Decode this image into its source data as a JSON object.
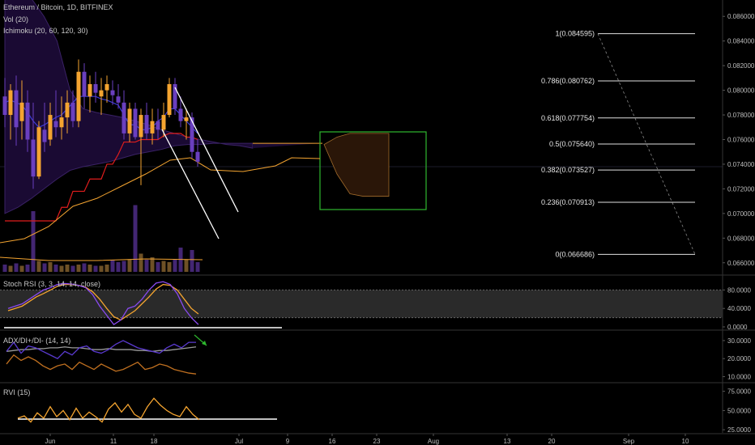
{
  "header": {
    "title": "Ethereum / Bitcoin, 1D, BITFINEX",
    "volume": "Vol (20)",
    "ichimoku": "Ichimoku (20, 60, 120, 30)"
  },
  "colors": {
    "bull": "#f4a430",
    "bear": "#6a3fbf",
    "kijun": "#e11d1d",
    "tenkan": "#3b3bd8",
    "cloud": "#1a0a33",
    "lagging": "#f4a430",
    "box": "#2eb82e"
  },
  "chart_data": {
    "type": "candlestick",
    "price_axis": {
      "ylim": [
        0.065,
        0.087
      ],
      "ticks": [
        "0.086000",
        "0.084000",
        "0.082000",
        "0.080000",
        "0.078000",
        "0.076000",
        "0.074000",
        "0.072000",
        "0.070000",
        "0.068000",
        "0.066000"
      ]
    },
    "x_ticks": [
      "Jun",
      "11",
      "18",
      "Jul",
      "9",
      "16",
      "23",
      "Aug",
      "13",
      "20",
      "Sep",
      "10"
    ],
    "candles": [
      [
        0.0795,
        0.081,
        0.077,
        0.078
      ],
      [
        0.078,
        0.0805,
        0.076,
        0.08
      ],
      [
        0.08,
        0.0812,
        0.0755,
        0.077
      ],
      [
        0.0775,
        0.0808,
        0.076,
        0.079
      ],
      [
        0.079,
        0.08,
        0.075,
        0.076
      ],
      [
        0.076,
        0.079,
        0.072,
        0.073
      ],
      [
        0.073,
        0.0775,
        0.0728,
        0.077
      ],
      [
        0.0768,
        0.079,
        0.075,
        0.0758
      ],
      [
        0.076,
        0.079,
        0.0755,
        0.078
      ],
      [
        0.0775,
        0.08,
        0.0762,
        0.077
      ],
      [
        0.077,
        0.0795,
        0.076,
        0.0778
      ],
      [
        0.0778,
        0.08,
        0.0765,
        0.079
      ],
      [
        0.079,
        0.08,
        0.077,
        0.0775
      ],
      [
        0.0775,
        0.0825,
        0.077,
        0.0815
      ],
      [
        0.0815,
        0.0822,
        0.0785,
        0.0795
      ],
      [
        0.0795,
        0.0812,
        0.0782,
        0.0805
      ],
      [
        0.0805,
        0.0815,
        0.079,
        0.0798
      ],
      [
        0.0795,
        0.081,
        0.078,
        0.08
      ],
      [
        0.08,
        0.0812,
        0.079,
        0.0805
      ],
      [
        0.08,
        0.0808,
        0.0788,
        0.0796
      ],
      [
        0.0795,
        0.0805,
        0.0785,
        0.079
      ],
      [
        0.079,
        0.08,
        0.076,
        0.0765
      ],
      [
        0.0765,
        0.079,
        0.0758,
        0.0785
      ],
      [
        0.0785,
        0.079,
        0.076,
        0.0762
      ],
      [
        0.0762,
        0.0785,
        0.0723,
        0.078
      ],
      [
        0.078,
        0.079,
        0.076,
        0.0765
      ],
      [
        0.0765,
        0.0785,
        0.0756,
        0.0775
      ],
      [
        0.0775,
        0.0785,
        0.076,
        0.0768
      ],
      [
        0.0768,
        0.079,
        0.0762,
        0.078
      ],
      [
        0.078,
        0.081,
        0.0778,
        0.0805
      ],
      [
        0.0805,
        0.081,
        0.078,
        0.0785
      ],
      [
        0.0785,
        0.0795,
        0.077,
        0.0775
      ],
      [
        0.0775,
        0.0785,
        0.076,
        0.0778
      ],
      [
        0.0778,
        0.0782,
        0.0745,
        0.075
      ],
      [
        0.075,
        0.076,
        0.0738,
        0.0742
      ]
    ],
    "volume": [
      0.06,
      0.05,
      0.07,
      0.05,
      0.06,
      0.5,
      0.09,
      0.07,
      0.08,
      0.06,
      0.05,
      0.06,
      0.05,
      0.06,
      0.07,
      0.06,
      0.05,
      0.05,
      0.06,
      0.1,
      0.08,
      0.09,
      0.1,
      0.55,
      0.15,
      0.1,
      0.12,
      0.08,
      0.09,
      0.08,
      0.1,
      0.2,
      0.1,
      0.18,
      0.08
    ],
    "kijun": [
      0.0694,
      0.0694,
      0.0694,
      0.0694,
      0.0694,
      0.0694,
      0.0694,
      0.0694,
      0.0694,
      0.0694,
      0.0705,
      0.0705,
      0.0718,
      0.0718,
      0.0718,
      0.0728,
      0.0728,
      0.0728,
      0.074,
      0.074,
      0.0748,
      0.0758,
      0.0758,
      0.0758,
      0.076,
      0.076,
      0.076,
      0.076,
      0.0763,
      0.0765,
      0.0765,
      0.0765,
      0.0762,
      0.0762,
      0.076
    ],
    "tenkan": [
      0.079,
      0.0792,
      0.079,
      0.0788,
      0.0782,
      0.0775,
      0.077,
      0.0772,
      0.0775,
      0.0778,
      0.078,
      0.0785,
      0.079,
      0.0795,
      0.0795,
      0.0795,
      0.0795,
      0.0793,
      0.0792,
      0.079,
      0.0788,
      0.078,
      0.0772,
      0.0772,
      0.0768,
      0.0768,
      0.077,
      0.0775,
      0.0778,
      0.0785,
      0.0785,
      0.078,
      0.0775,
      0.077,
      0.0765
    ],
    "cloud_top": [
      0.09,
      0.089,
      0.0875,
      0.086,
      0.084,
      0.08,
      0.0785,
      0.0782,
      0.078,
      0.0778,
      0.0775,
      0.0772,
      0.0768,
      0.0765,
      0.0762,
      0.076,
      0.0758,
      0.0756,
      0.0755,
      0.0753
    ],
    "cloud_bottom": [
      0.07,
      0.0705,
      0.0712,
      0.072,
      0.0728,
      0.0735,
      0.0738,
      0.074,
      0.0742,
      0.0745,
      0.0748,
      0.075,
      0.0752,
      0.0755,
      0.0756,
      0.0756,
      0.0757,
      0.0757,
      0.0757,
      0.0757
    ],
    "future_cloud_top": [
      0.0756,
      0.0762,
      0.0765,
      0.0765,
      0.0765,
      0.0765
    ],
    "future_cloud_bottom": [
      0.0756,
      0.0732,
      0.0716,
      0.0714,
      0.0714,
      0.0714
    ],
    "fib_levels": [
      {
        "label": "1(0.084595)",
        "value": 0.084595
      },
      {
        "label": "0.786(0.080762)",
        "value": 0.080762
      },
      {
        "label": "0.618(0.077754)",
        "value": 0.077754
      },
      {
        "label": "0.5(0.075640)",
        "value": 0.07564
      },
      {
        "label": "0.382(0.073527)",
        "value": 0.073527
      },
      {
        "label": "0.236(0.070913)",
        "value": 0.070913
      },
      {
        "label": "0(0.066686)",
        "value": 0.066686
      }
    ],
    "stoch_rsi": {
      "title": "Stoch RSI (3, 3, 14, 14, close)",
      "ylim": [
        0,
        100
      ],
      "ticks": [
        "80.0000",
        "40.0000",
        "0.0000"
      ],
      "band": [
        20,
        80
      ],
      "k": [
        40,
        45,
        50,
        60,
        70,
        80,
        85,
        92,
        94,
        93,
        90,
        85,
        70,
        45,
        25,
        5,
        15,
        40,
        45,
        60,
        80,
        95,
        98,
        92,
        72,
        40,
        20,
        5
      ],
      "d": [
        35,
        40,
        45,
        55,
        65,
        72,
        80,
        88,
        92,
        92,
        90,
        86,
        76,
        60,
        40,
        22,
        15,
        25,
        35,
        50,
        65,
        82,
        92,
        90,
        80,
        60,
        40,
        28
      ]
    },
    "adx": {
      "title": "ADX/DI+/DI- (14, 14)",
      "ylim": [
        8,
        34
      ],
      "ticks": [
        "30.0000",
        "20.0000",
        "10.0000"
      ],
      "adx": [
        24,
        24.5,
        25,
        25,
        25.5,
        25.5,
        26,
        26,
        26.5,
        26,
        26,
        25.5,
        25,
        25,
        25.5,
        25,
        25,
        25,
        24.5,
        24.5,
        24,
        24.5,
        24.5,
        25,
        25.5,
        26,
        26.5
      ],
      "di_plus": [
        24,
        29,
        23,
        27,
        26,
        24,
        22,
        20,
        24,
        22,
        26,
        27,
        24,
        23,
        25,
        28,
        30,
        28,
        26,
        25,
        24,
        23,
        26,
        28,
        26,
        29,
        29
      ],
      "di_minus": [
        17,
        22,
        19,
        21,
        19,
        16,
        14,
        16,
        17,
        14,
        18,
        16,
        14,
        17,
        15,
        13,
        14,
        16,
        18,
        14,
        15,
        17,
        16,
        14,
        13,
        12,
        11.5
      ]
    },
    "rvi": {
      "title": "RVI (15)",
      "ylim": [
        22,
        82
      ],
      "ticks": [
        "75.0000",
        "50.0000",
        "25.0000"
      ],
      "values": [
        40,
        43,
        35,
        47,
        40,
        55,
        42,
        50,
        38,
        53,
        40,
        48,
        42,
        35,
        52,
        60,
        48,
        58,
        45,
        40,
        55,
        66,
        57,
        50,
        45,
        42,
        55,
        45,
        38
      ]
    }
  }
}
